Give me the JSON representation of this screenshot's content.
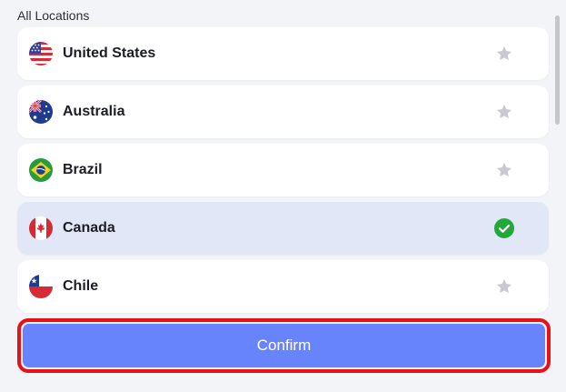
{
  "section_title": "All Locations",
  "locations": [
    {
      "name": "United States",
      "flag": "us-flag-icon",
      "status": "star",
      "selected": false
    },
    {
      "name": "Australia",
      "flag": "australia-flag-icon",
      "status": "star",
      "selected": false
    },
    {
      "name": "Brazil",
      "flag": "brazil-flag-icon",
      "status": "star",
      "selected": false
    },
    {
      "name": "Canada",
      "flag": "canada-flag-icon",
      "status": "check",
      "selected": true
    },
    {
      "name": "Chile",
      "flag": "chile-flag-icon",
      "status": "star",
      "selected": false
    }
  ],
  "confirm_label": "Confirm",
  "colors": {
    "background": "#f3f4f8",
    "row": "#ffffff",
    "selected_row": "#e2e7f7",
    "star": "#c8cad0",
    "check": "#22a83a",
    "confirm_button": "#6884fc",
    "highlight_border": "#e8111a"
  }
}
